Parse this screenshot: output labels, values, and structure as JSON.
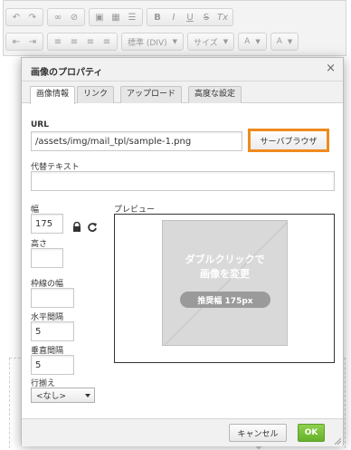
{
  "dialog": {
    "title": "画像のプロパティ",
    "close_glyph": "×",
    "tabs": [
      {
        "label": "画像情報",
        "active": true
      },
      {
        "label": "リンク",
        "active": false
      },
      {
        "label": "アップロード",
        "active": false
      },
      {
        "label": "高度な設定",
        "active": false
      }
    ],
    "url_label": "URL",
    "url_value": "/assets/img/mail_tpl/sample-1.png",
    "browse_label": "サーバブラウザ",
    "alt_label": "代替テキスト",
    "alt_value": "",
    "width_label": "幅",
    "width_value": "175",
    "height_label": "高さ",
    "height_value": "",
    "border_label": "枠線の幅",
    "border_value": "",
    "hspace_label": "水平間隔",
    "hspace_value": "5",
    "vspace_label": "垂直間隔",
    "vspace_value": "5",
    "align_label": "行揃え",
    "align_value": "<なし>",
    "preview_label": "プレビュー",
    "preview_text_line1": "ダブルクリックで",
    "preview_text_line2": "画像を変更",
    "preview_badge": "推奨幅 175px",
    "cancel_label": "キャンセル",
    "ok_label": "OK"
  },
  "toolbar": {
    "format_label": "標準 (DIV)",
    "size_label": "サイズ",
    "font_color_label": "A",
    "bg_color_label": "A",
    "bold": "B",
    "italic": "I",
    "underline": "U",
    "strike": "S",
    "clear": "Tx"
  },
  "colors": {
    "browse_highlight": "#ef8a1f",
    "ok_green": "#66b12a"
  }
}
